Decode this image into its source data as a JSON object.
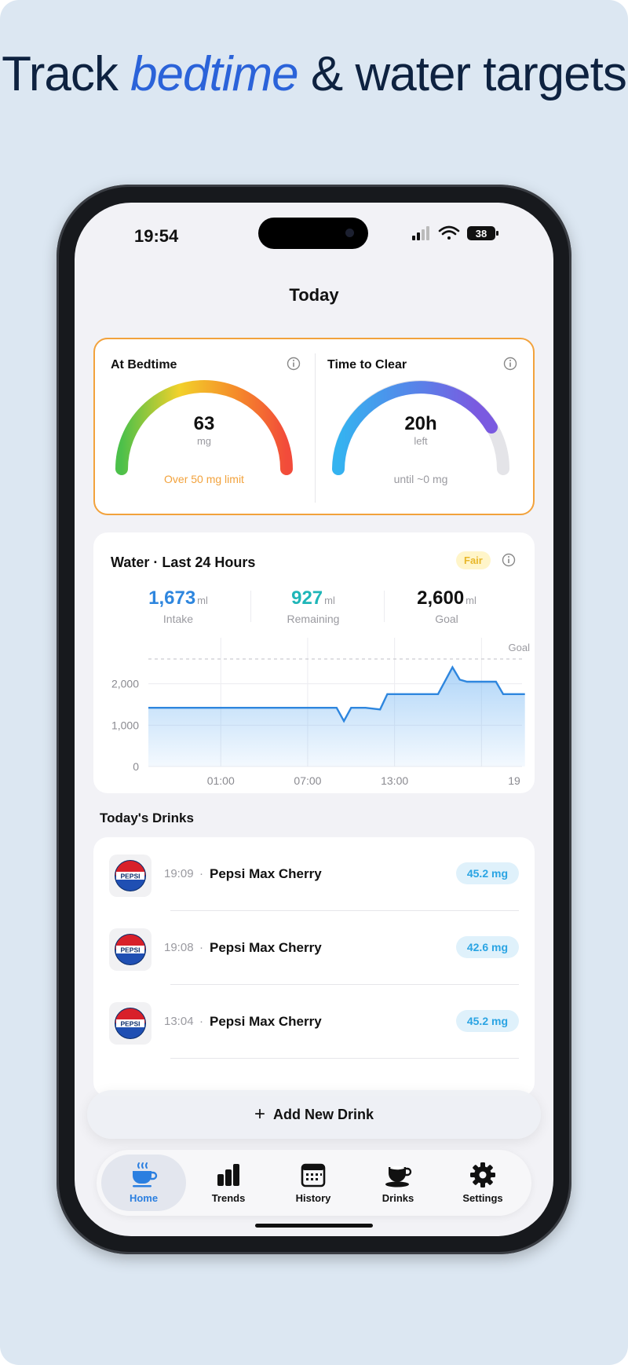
{
  "headline": {
    "part1": "Track ",
    "accent": "bedtime",
    "part2": " & water targets"
  },
  "status": {
    "time": "19:54",
    "battery": "38"
  },
  "nav": {
    "title": "Today"
  },
  "bedtime_card": {
    "left": {
      "label": "At Bedtime",
      "value": "63",
      "unit": "mg",
      "note": "Over 50 mg limit",
      "note_color": "#f2a23c"
    },
    "right": {
      "label": "Time to Clear",
      "value": "20h",
      "unit": "left",
      "note": "until ~0 mg",
      "note_color": "#9a9aa0"
    }
  },
  "water_card": {
    "title": "Water · Last 24 Hours",
    "badge": "Fair",
    "stats": [
      {
        "value": "1,673",
        "unit": "ml",
        "label": "Intake",
        "color": "#2e86de"
      },
      {
        "value": "927",
        "unit": "ml",
        "label": "Remaining",
        "color": "#1fb6b8"
      },
      {
        "value": "2,600",
        "unit": "ml",
        "label": "Goal",
        "color": "#111111"
      }
    ]
  },
  "chart_data": {
    "type": "area",
    "y_ticks": [
      "2,000",
      "1,000",
      "0"
    ],
    "x_ticks": [
      "01:00",
      "07:00",
      "13:00",
      "19"
    ],
    "goal_label": "Goal",
    "goal_value": 2600,
    "ylim": [
      0,
      3000
    ],
    "x_hours": [
      20,
      24,
      26,
      28,
      30,
      32,
      33.0,
      33.5,
      34,
      35,
      36,
      36.5,
      37,
      38,
      39,
      40,
      41,
      41.5,
      42,
      43,
      44,
      44.5,
      45,
      45.5,
      46
    ],
    "values": [
      1420,
      1420,
      1420,
      1420,
      1420,
      1420,
      1420,
      1100,
      1420,
      1420,
      1380,
      1750,
      1750,
      1750,
      1750,
      1750,
      2400,
      2100,
      2050,
      2050,
      2050,
      1750,
      1750,
      1750,
      1750
    ],
    "xlim": [
      20,
      45.8
    ],
    "line_color": "#2e86de"
  },
  "drinks": {
    "section_title": "Today's Drinks",
    "items": [
      {
        "time": "19:09",
        "name": "Pepsi Max Cherry",
        "amount": "45.2 mg",
        "logo_text": "PEPSI"
      },
      {
        "time": "19:08",
        "name": "Pepsi Max Cherry",
        "amount": "42.6 mg",
        "logo_text": "PEPSI"
      },
      {
        "time": "13:04",
        "name": "Pepsi Max Cherry",
        "amount": "45.2 mg",
        "logo_text": "PEPSI"
      }
    ]
  },
  "add_button": {
    "label": "Add New Drink"
  },
  "tabs": [
    {
      "label": "Home",
      "icon": "coffee-cup-icon",
      "active": true
    },
    {
      "label": "Trends",
      "icon": "bar-chart-icon",
      "active": false
    },
    {
      "label": "History",
      "icon": "calendar-icon",
      "active": false
    },
    {
      "label": "Drinks",
      "icon": "cup-saucer-icon",
      "active": false
    },
    {
      "label": "Settings",
      "icon": "gear-icon",
      "active": false
    }
  ],
  "colors": {
    "accent": "#2b63d9",
    "headline": "#0e2240",
    "warning": "#f2a23c"
  }
}
